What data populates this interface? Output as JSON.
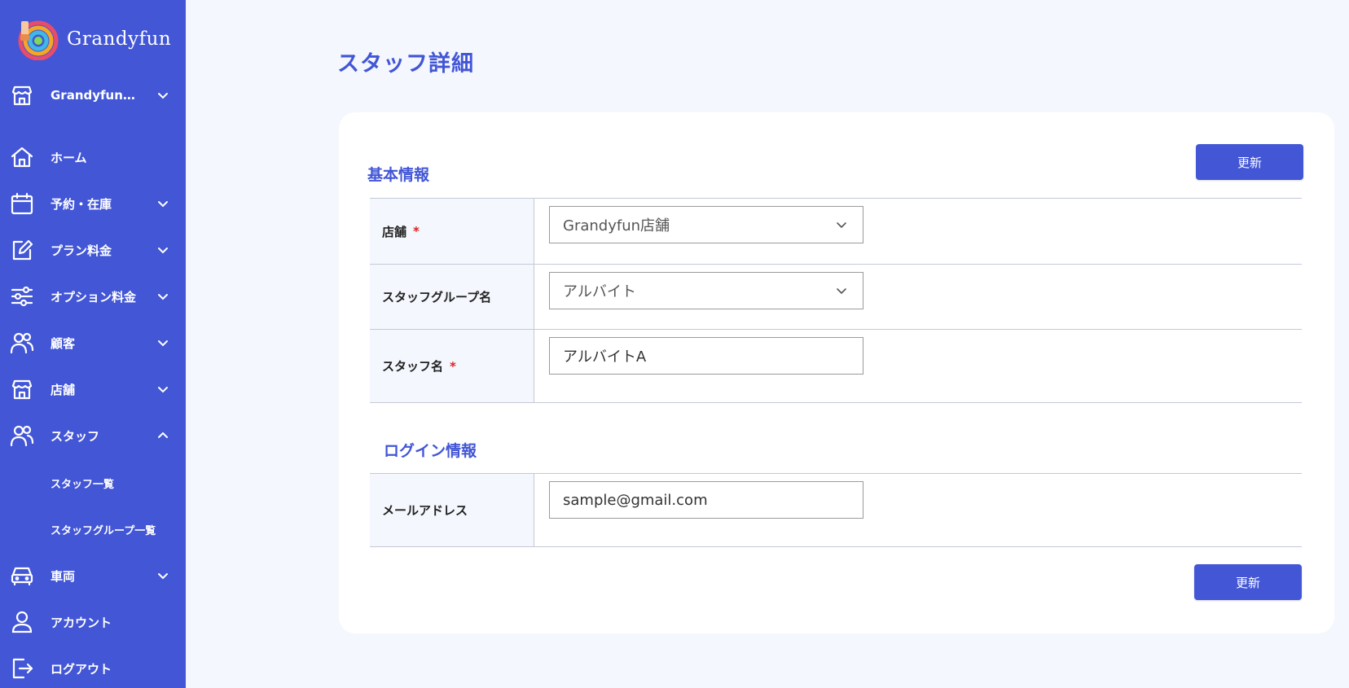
{
  "app": {
    "brand": "Grandyfun"
  },
  "sidebar": {
    "store_selector": "Grandyfun…",
    "items": [
      {
        "label": "ホーム"
      },
      {
        "label": "予約・在庫"
      },
      {
        "label": "プラン料金"
      },
      {
        "label": "オプション料金"
      },
      {
        "label": "顧客"
      },
      {
        "label": "店舗"
      },
      {
        "label": "スタッフ"
      },
      {
        "label": "車両"
      },
      {
        "label": "アカウント"
      },
      {
        "label": "ログアウト"
      }
    ],
    "staff_subitems": [
      {
        "label": "スタッフ一覧"
      },
      {
        "label": "スタッフグループ一覧"
      }
    ]
  },
  "page": {
    "title": "スタッフ詳細",
    "update_label_top": "更新",
    "update_label_bottom": "更新"
  },
  "basic_info": {
    "title": "基本情報",
    "store_label": "店舗",
    "store_value": "Grandyfun店舗",
    "group_label": "スタッフグループ名",
    "group_value": "アルバイト",
    "name_label": "スタッフ名",
    "name_value": "アルバイトA",
    "required_mark": "*"
  },
  "login_info": {
    "title": "ログイン情報",
    "email_label": "メールアドレス",
    "email_value": "sample@gmail.com"
  },
  "colors": {
    "accent": "#4256d6",
    "background": "#f4f7fd",
    "required": "#e01e1e"
  }
}
